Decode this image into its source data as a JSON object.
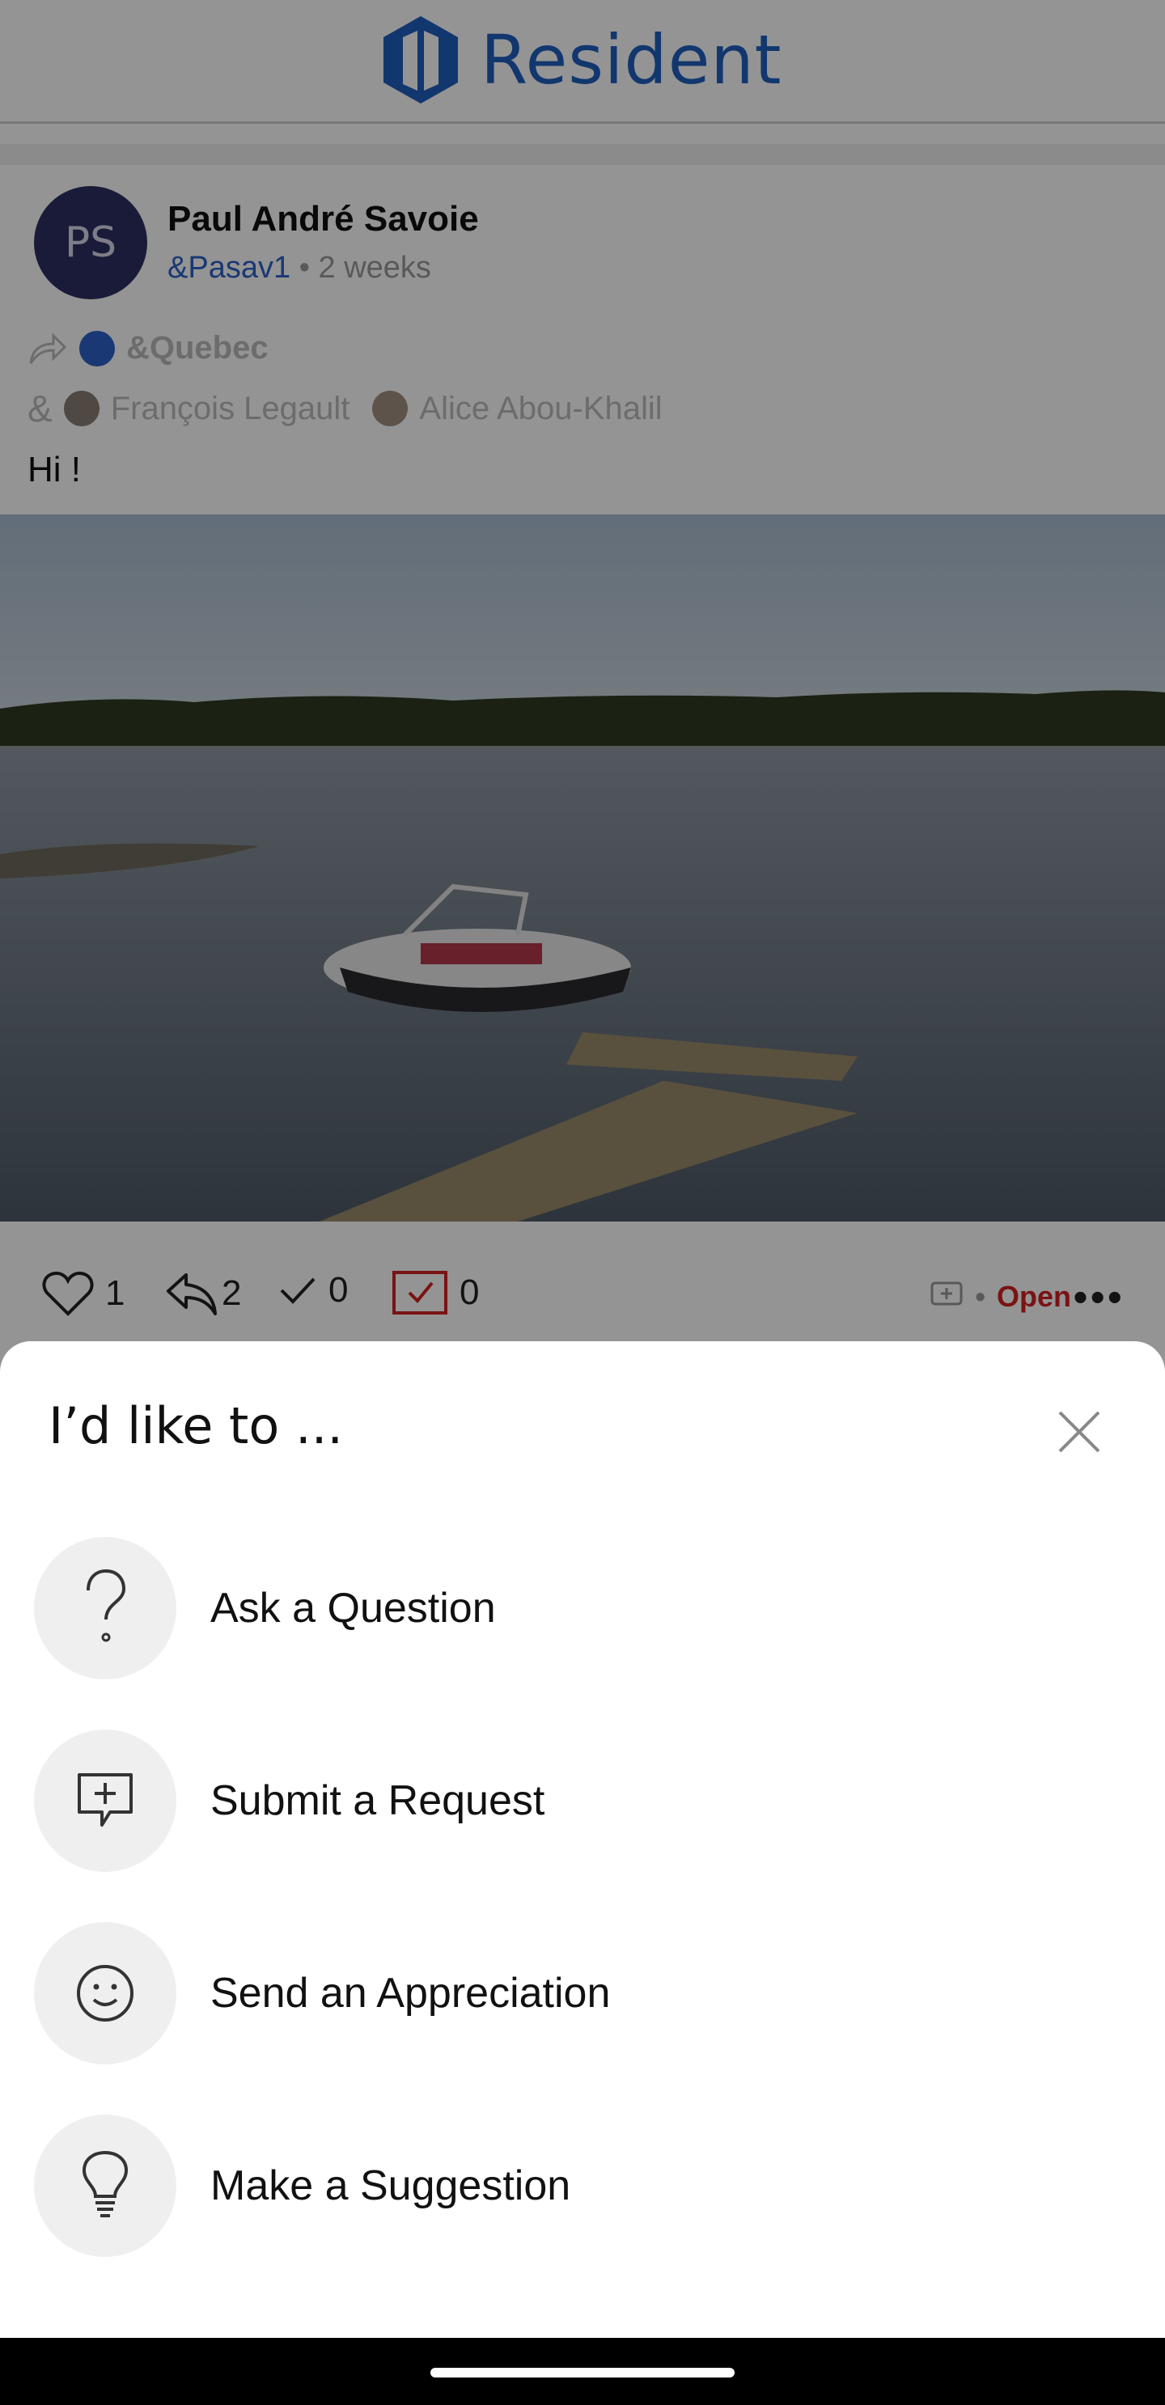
{
  "app": {
    "name": "Resident",
    "brand_color": "#1f5fbf"
  },
  "post": {
    "avatar_initials": "PS",
    "author": "Paul André Savoie",
    "handle": "&Pasav1",
    "time": " • 2 weeks",
    "shared_to": "&Quebec",
    "ampersand": "&",
    "mentions": [
      "François Legault",
      "Alice Abou-Khalil"
    ],
    "text": "Hi !",
    "photo_alt": "Boat docked at a wooden pier on a river",
    "counts": {
      "likes": "1",
      "replies": "2",
      "checks": "0",
      "tasks": "0"
    },
    "status_separator": "•",
    "status": "Open",
    "more": "•••"
  },
  "sheet": {
    "title": "I’d like to ...",
    "options": [
      {
        "label": "Ask a Question",
        "icon": "question-icon"
      },
      {
        "label": "Submit a Request",
        "icon": "request-icon"
      },
      {
        "label": "Send an Appreciation",
        "icon": "smile-icon"
      },
      {
        "label": "Make a Suggestion",
        "icon": "lightbulb-icon"
      }
    ]
  },
  "colors": {
    "status_open": "#d32222",
    "handle": "#2b61c9",
    "avatar_bg": "#2b2f63"
  }
}
